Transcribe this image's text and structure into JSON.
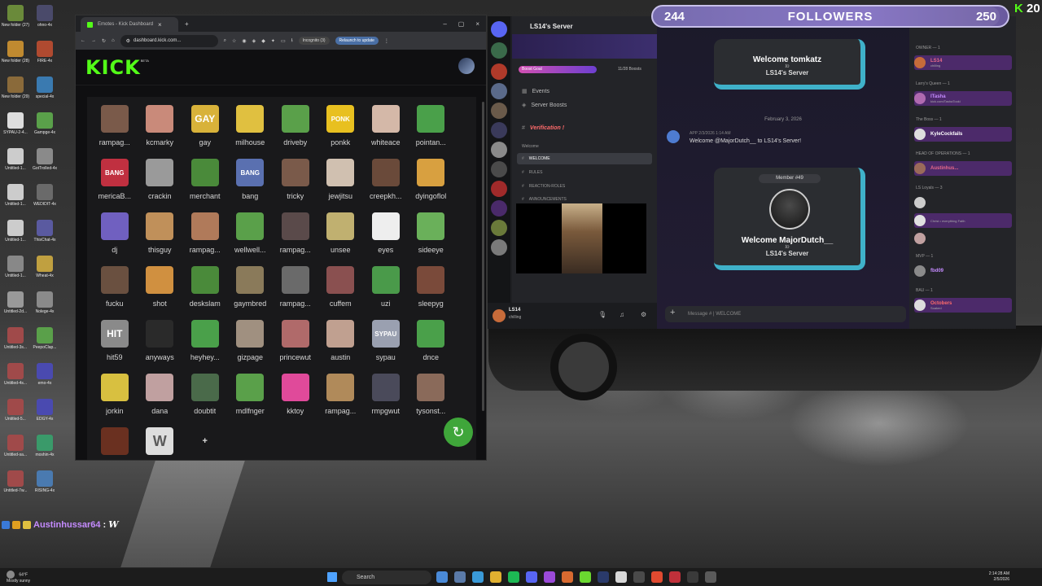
{
  "overlay": {
    "followers_current": "244",
    "followers_label": "FOLLOWERS",
    "followers_target": "250",
    "followers_progress": 0.976,
    "kick_count": "20"
  },
  "chat_overlay": {
    "username": "Austinhussar64",
    "message": "W"
  },
  "desktop": {
    "icons": [
      {
        "label": "New folder (27)"
      },
      {
        "label": "ohno-4x"
      },
      {
        "label": "New folder (28)"
      },
      {
        "label": "FIRE-4x"
      },
      {
        "label": "New folder (29)"
      },
      {
        "label": "special-4x"
      },
      {
        "label": "SYPAU-2-4..."
      },
      {
        "label": "Gampge-4x"
      },
      {
        "label": "Untitled-1..."
      },
      {
        "label": "GotTrolled-4x"
      },
      {
        "label": "Untitled-1..."
      },
      {
        "label": "WEDIDIT-4x"
      },
      {
        "label": "Untitled-1..."
      },
      {
        "label": "ThisChat-4x"
      },
      {
        "label": "Untitled-1..."
      },
      {
        "label": "Wheat-4x"
      },
      {
        "label": "Untitled-2d..."
      },
      {
        "label": "Nolege-4x"
      },
      {
        "label": "Untitled-3s..."
      },
      {
        "label": "PeepoClap..."
      },
      {
        "label": "Untitled-4s..."
      },
      {
        "label": "emo-4x"
      },
      {
        "label": "Untitled-5..."
      },
      {
        "label": "EDGY-4x"
      },
      {
        "label": "Untitled-sa..."
      },
      {
        "label": "moshin-4x"
      },
      {
        "label": "Untitled-7w..."
      },
      {
        "label": "RISING-4x"
      }
    ]
  },
  "browser": {
    "tab_title": "Emotes - Kick Dashboard",
    "url": "dashboard.kick.com...",
    "incognito_label": "Incognito (3)",
    "relaunch_label": "Relaunch to update",
    "logo": "KICK",
    "beta": "BETA",
    "emotes": [
      {
        "name": "rampag...",
        "color": "#7a5a4a"
      },
      {
        "name": "kcmarky",
        "color": "#c98a7a"
      },
      {
        "name": "gay",
        "color": "#d8b23a",
        "text": "GAY"
      },
      {
        "name": "milhouse",
        "color": "#e0c040"
      },
      {
        "name": "driveby",
        "color": "#5aa04a"
      },
      {
        "name": "ponkk",
        "color": "#e8c020",
        "text": "PONK"
      },
      {
        "name": "whiteace",
        "color": "#d4b8a8"
      },
      {
        "name": "pointan...",
        "color": "#4aa04a"
      },
      {
        "name": "mericaB...",
        "color": "#c03040",
        "text": "BANG"
      },
      {
        "name": "crackin",
        "color": "#9a9a9a"
      },
      {
        "name": "merchant",
        "color": "#4a8a3a"
      },
      {
        "name": "bang",
        "color": "#5a70b0",
        "text": "BANG"
      },
      {
        "name": "tricky",
        "color": "#7a5a4a"
      },
      {
        "name": "jewjitsu",
        "color": "#d0c0b0"
      },
      {
        "name": "creepkh...",
        "color": "#6a4a3a"
      },
      {
        "name": "dyingoflol",
        "color": "#d8a040"
      },
      {
        "name": "dj",
        "color": "#7060c0"
      },
      {
        "name": "thisguy",
        "color": "#c0905a"
      },
      {
        "name": "rampag...",
        "color": "#b07a5a"
      },
      {
        "name": "wellwell...",
        "color": "#5aa04a"
      },
      {
        "name": "rampag...",
        "color": "#5a4a4a"
      },
      {
        "name": "unsee",
        "color": "#c0b070"
      },
      {
        "name": "eyes",
        "color": "#eeeeee"
      },
      {
        "name": "sideeye",
        "color": "#6ab05a"
      },
      {
        "name": "fucku",
        "color": "#6a5040"
      },
      {
        "name": "shot",
        "color": "#d09040"
      },
      {
        "name": "deskslam",
        "color": "#4a8a3a"
      },
      {
        "name": "gaymbred",
        "color": "#8a7a5a"
      },
      {
        "name": "rampag...",
        "color": "#6a6a6a"
      },
      {
        "name": "cuffem",
        "color": "#8a5050"
      },
      {
        "name": "uzi",
        "color": "#4a9a4a"
      },
      {
        "name": "sleepyg",
        "color": "#7a4a3a"
      },
      {
        "name": "hit59",
        "color": "#8a8a8a",
        "text": "HIT"
      },
      {
        "name": "anyways",
        "color": "#2a2a2a"
      },
      {
        "name": "heyhey...",
        "color": "#4aa04a"
      },
      {
        "name": "gizpage",
        "color": "#a09080"
      },
      {
        "name": "princewut",
        "color": "#b06a6a"
      },
      {
        "name": "austin",
        "color": "#c0a090"
      },
      {
        "name": "sypau",
        "color": "#9aa0b0",
        "text": "SYPAU"
      },
      {
        "name": "dnce",
        "color": "#4aa04a"
      },
      {
        "name": "jorkin",
        "color": "#d8c040"
      },
      {
        "name": "dana",
        "color": "#c0a0a0"
      },
      {
        "name": "doubtit",
        "color": "#4a6a4a"
      },
      {
        "name": "mdlfnger",
        "color": "#5aa04a"
      },
      {
        "name": "kktoy",
        "color": "#e04a9a"
      },
      {
        "name": "rampag...",
        "color": "#b08a5a"
      },
      {
        "name": "rmpgwut",
        "color": "#4a4a5a"
      },
      {
        "name": "tysonst...",
        "color": "#8a6a5a"
      },
      {
        "name": "",
        "color": "#6a3020"
      },
      {
        "name": "",
        "color": "#dddddd",
        "text": "W"
      }
    ]
  },
  "discord": {
    "server_name": "LS14's Server",
    "boost_goal_label": "Boost Goal",
    "boost_count": "11/28 Boosts",
    "events_label": "Events",
    "server_boosts_label": "Server Boosts",
    "verification_channel": "Verification !",
    "welcome_category": "Welcome",
    "channels": [
      "WELCOME",
      "RULES",
      "REACTION-ROLES",
      "ANNOUNCEMENTS"
    ],
    "user_name": "LS14",
    "user_status": "chilling",
    "welcome1": {
      "title": "Welcome tomkatz",
      "to": "to",
      "server": "LS14's Server"
    },
    "date_separator": "February 3, 2026",
    "bot_meta": "APP 2/3/2026 1:14 AM",
    "bot_message": "Welcome @MajorDutch__ to LS14's Server!",
    "welcome2": {
      "member": "Member #49",
      "title": "Welcome MajorDutch__",
      "to": "to",
      "server": "LS14's Server"
    },
    "message_placeholder": "Message # | WELCOME",
    "members": {
      "owner_section": "OWNER — 1",
      "owner_name": "LS14",
      "owner_status": "chilling",
      "queen_section": "Larry's Queen — 1",
      "queen_name": "ITasha",
      "queen_status": "kick.com/TashaTooki",
      "boss_section": "The Boss — 1",
      "boss_name": "KyleCockfails",
      "ops_section": "HEAD OF OPERATIONS — 1",
      "ops_name": "Austinhus...",
      "loyals_section": "LS Loyals — 3",
      "loyals_status": "Christ • everything Faith",
      "mvp_section": "MVP — 1",
      "mvp_name": "fbd09",
      "bau_section": "BAU — 1",
      "bau_name": "Octobers",
      "bau_status": "Soaked"
    }
  },
  "taskbar": {
    "temp": "64°F",
    "weather": "Mostly sunny",
    "search_placeholder": "Search",
    "time": "2:14:28 AM",
    "date": "2/5/2026"
  }
}
